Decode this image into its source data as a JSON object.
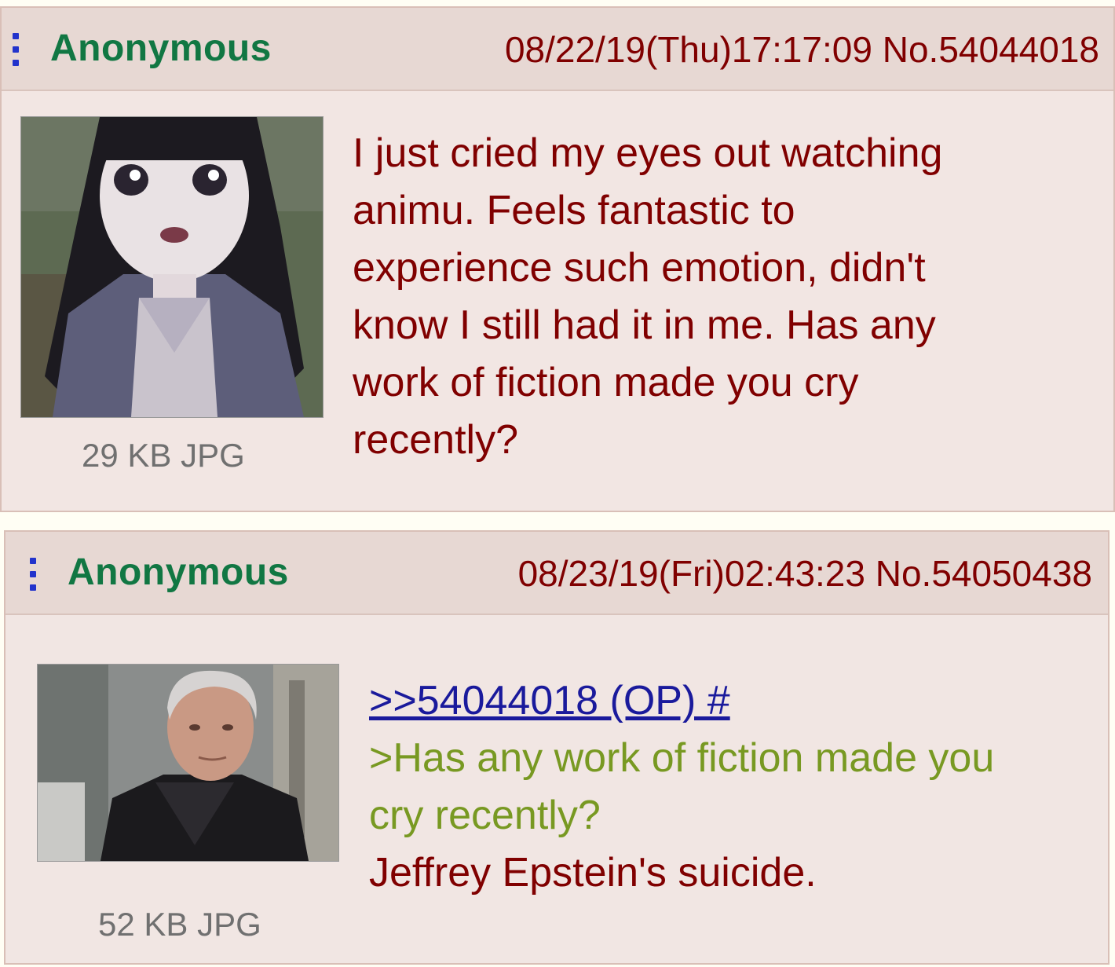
{
  "posts": [
    {
      "name": "Anonymous",
      "datetime": "08/22/19(Thu)17:17:09",
      "number": "No.54044018",
      "file_info": "29 KB JPG",
      "thumbnail": "anime-girl-crying-thumbnail",
      "lines": [
        "I just cried my eyes out watching",
        "animu. Feels fantastic to",
        "experience such emotion, didn't",
        "know I still had it in me. Has any",
        "work of fiction made you cry",
        "recently?"
      ]
    },
    {
      "name": "Anonymous",
      "datetime": "08/23/19(Fri)02:43:23",
      "number": "No.54050438",
      "file_info": "52 KB JPG",
      "thumbnail": "man-portrait-thumbnail",
      "quote_link": ">>54044018 (OP) #",
      "greentext_lines": [
        ">Has any work of fiction made you",
        "cry recently?"
      ],
      "reply_text": "Jeffrey Epstein's suicide."
    }
  ],
  "colors": {
    "name": "#117743",
    "meta": "#800000",
    "body": "#800000",
    "greentext": "#789922",
    "quotelink": "#1a1a9c",
    "menu": "#2233cc"
  }
}
